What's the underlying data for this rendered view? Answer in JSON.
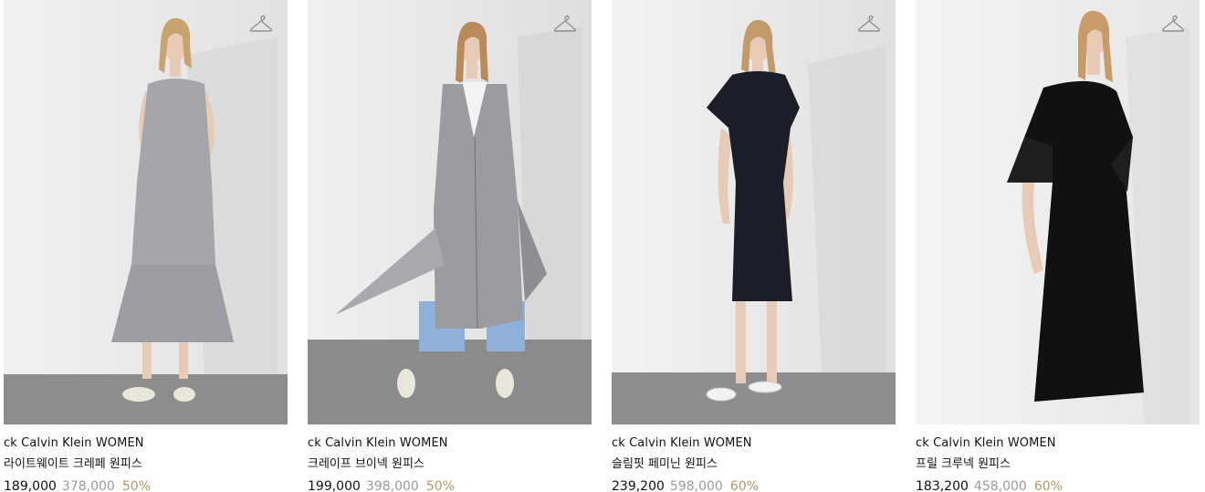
{
  "accent": {
    "discount": "#b89467",
    "original_price": "#9a9a9a",
    "text": "#111111"
  },
  "icons": {
    "wishlist": "hanger-icon"
  },
  "products": [
    {
      "brand": "ck Calvin Klein WOMEN",
      "name": "라이트웨이트 크레페 원피스",
      "sale_price": "189,000",
      "original_price": "378,000",
      "discount": "50%",
      "garment_color": "#a4a6ab"
    },
    {
      "brand": "ck Calvin Klein WOMEN",
      "name": "크레이프 브이넥 원피스",
      "sale_price": "199,000",
      "original_price": "398,000",
      "discount": "50%",
      "garment_color": "#9a9ca1"
    },
    {
      "brand": "ck Calvin Klein WOMEN",
      "name": "슬림핏 페미닌 원피스",
      "sale_price": "239,200",
      "original_price": "598,000",
      "discount": "60%",
      "garment_color": "#1b1e28"
    },
    {
      "brand": "ck Calvin Klein WOMEN",
      "name": "프릴 크루넥 원피스",
      "sale_price": "183,200",
      "original_price": "458,000",
      "discount": "60%",
      "garment_color": "#111111"
    }
  ]
}
